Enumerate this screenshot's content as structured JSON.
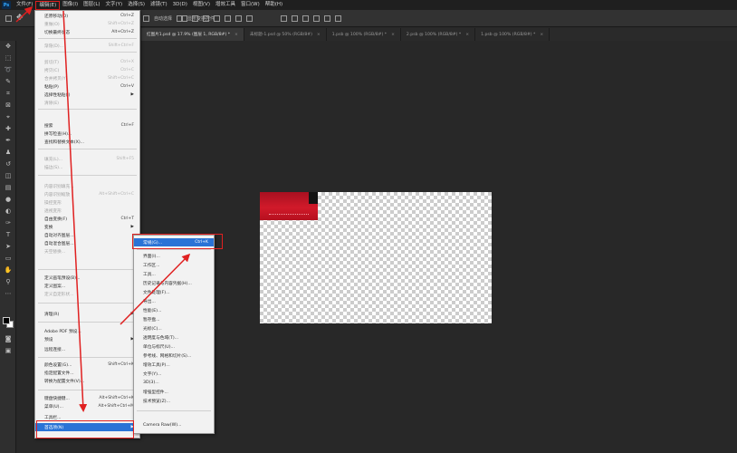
{
  "app": {
    "logo": "Ps"
  },
  "menubar": [
    "文件(F)",
    "编辑(E)",
    "图像(I)",
    "图层(L)",
    "文字(Y)",
    "选择(S)",
    "滤镜(T)",
    "3D(D)",
    "视图(V)",
    "增效工具",
    "窗口(W)",
    "帮助(H)"
  ],
  "optbar": {
    "auto_select": "自动选择",
    "transform": "显示变换控件"
  },
  "tabs": [
    {
      "label": "红图片1.psd @ 17.9% (图层 1, RGB/8#) *",
      "active": true
    },
    {
      "label": "未标题-1.psd @ 50% (RGB/8#)",
      "active": false
    },
    {
      "label": "1.psb @ 100% (RGB/8#) *",
      "active": false
    },
    {
      "label": "2.psb @ 100% (RGB/8#) *",
      "active": false
    },
    {
      "label": "1.psb @ 100% (RGB/8#) *",
      "active": false
    }
  ],
  "edit_menu": [
    {
      "label": "还原移动(O)",
      "shortcut": "Ctrl+Z"
    },
    {
      "label": "重做(O)",
      "shortcut": "Shift+Ctrl+Z",
      "disabled": true
    },
    {
      "label": "切换最终状态",
      "shortcut": "Alt+Ctrl+Z"
    },
    {
      "label": "渐隐(D)...",
      "shortcut": "Shift+Ctrl+F",
      "disabled": true
    },
    {
      "label": "剪切(T)",
      "shortcut": "Ctrl+X",
      "disabled": true
    },
    {
      "label": "拷贝(C)",
      "shortcut": "Ctrl+C",
      "disabled": true
    },
    {
      "label": "合并拷贝(Y)",
      "shortcut": "Shift+Ctrl+C",
      "disabled": true
    },
    {
      "label": "粘贴(P)",
      "shortcut": "Ctrl+V"
    },
    {
      "label": "选择性粘贴(I)",
      "shortcut": "",
      "submenu": true
    },
    {
      "label": "清除(E)",
      "shortcut": "",
      "disabled": true
    },
    {
      "label": "搜索",
      "shortcut": "Ctrl+F"
    },
    {
      "label": "拼写检查(H)...",
      "shortcut": ""
    },
    {
      "label": "查找和替换文本(X)...",
      "shortcut": ""
    },
    {
      "label": "填充(L)...",
      "shortcut": "Shift+F5",
      "disabled": true
    },
    {
      "label": "描边(S)...",
      "shortcut": "",
      "disabled": true
    },
    {
      "label": "内容识别填充...",
      "shortcut": "",
      "disabled": true
    },
    {
      "label": "内容识别缩放",
      "shortcut": "Alt+Shift+Ctrl+C",
      "disabled": true
    },
    {
      "label": "操控变形",
      "shortcut": "",
      "disabled": true
    },
    {
      "label": "透视变形",
      "shortcut": "",
      "disabled": true
    },
    {
      "label": "自由变换(F)",
      "shortcut": "Ctrl+T"
    },
    {
      "label": "变换",
      "shortcut": "",
      "submenu": true
    },
    {
      "label": "自动对齐图层...",
      "shortcut": ""
    },
    {
      "label": "自动混合图层...",
      "shortcut": ""
    },
    {
      "label": "天空替换...",
      "shortcut": "",
      "disabled": true
    },
    {
      "label": "定义画笔预设(B)...",
      "shortcut": ""
    },
    {
      "label": "定义图案...",
      "shortcut": ""
    },
    {
      "label": "定义自定形状...",
      "shortcut": "",
      "disabled": true
    },
    {
      "label": "清理(R)",
      "shortcut": "",
      "submenu": true
    },
    {
      "label": "Adobe PDF 预设...",
      "shortcut": ""
    },
    {
      "label": "预设",
      "shortcut": "",
      "submenu": true
    },
    {
      "label": "远程连接...",
      "shortcut": ""
    },
    {
      "label": "颜色设置(G)...",
      "shortcut": "Shift+Ctrl+K"
    },
    {
      "label": "指定配置文件...",
      "shortcut": ""
    },
    {
      "label": "转换为配置文件(V)...",
      "shortcut": ""
    },
    {
      "label": "键盘快捷键...",
      "shortcut": "Alt+Shift+Ctrl+K"
    },
    {
      "label": "菜单(U)...",
      "shortcut": "Alt+Shift+Ctrl+M"
    },
    {
      "label": "工具栏...",
      "shortcut": ""
    },
    {
      "label": "首选项(N)",
      "shortcut": "",
      "submenu": true,
      "highlight": true
    }
  ],
  "pref_menu": [
    {
      "label": "常规(G)...",
      "shortcut": "Ctrl+K",
      "highlight": true
    },
    {
      "label": "界面(I)...",
      "shortcut": ""
    },
    {
      "label": "工作区...",
      "shortcut": ""
    },
    {
      "label": "工具...",
      "shortcut": ""
    },
    {
      "label": "历史记录与内容凭据(H)...",
      "shortcut": ""
    },
    {
      "label": "文件处理(F)...",
      "shortcut": ""
    },
    {
      "label": "导出...",
      "shortcut": ""
    },
    {
      "label": "性能(E)...",
      "shortcut": ""
    },
    {
      "label": "暂存盘...",
      "shortcut": ""
    },
    {
      "label": "光标(C)...",
      "shortcut": ""
    },
    {
      "label": "透明度与色域(T)...",
      "shortcut": ""
    },
    {
      "label": "单位与标尺(U)...",
      "shortcut": ""
    },
    {
      "label": "参考线、网格和切片(S)...",
      "shortcut": ""
    },
    {
      "label": "增效工具(P)...",
      "shortcut": ""
    },
    {
      "label": "文字(Y)...",
      "shortcut": ""
    },
    {
      "label": "3D(3)...",
      "shortcut": ""
    },
    {
      "label": "增强型控件...",
      "shortcut": ""
    },
    {
      "label": "技术预览(Z)...",
      "shortcut": ""
    },
    {
      "label": "Camera Raw(W)...",
      "shortcut": ""
    }
  ]
}
